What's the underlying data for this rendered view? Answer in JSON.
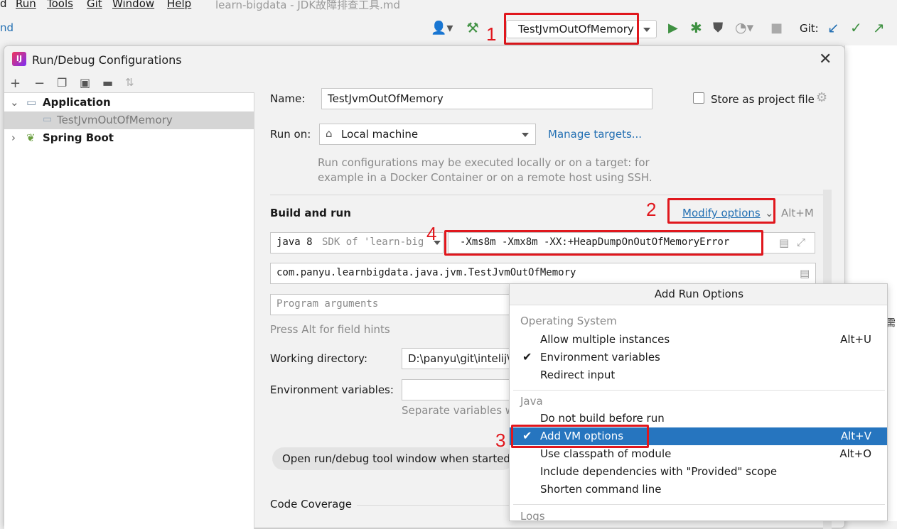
{
  "menubar": {
    "items": [
      {
        "label": "d",
        "mnemonic": ""
      },
      {
        "label": "Run",
        "mnemonic": "R"
      },
      {
        "label": "Tools",
        "mnemonic": "T"
      },
      {
        "label": "Git",
        "mnemonic": "G"
      },
      {
        "label": "Window",
        "mnemonic": "W"
      },
      {
        "label": "Help",
        "mnemonic": "H"
      }
    ],
    "window_title": "learn-bigdata - JDK故障排查工具.md"
  },
  "toolbar": {
    "left_text": "nd",
    "run_config": "TestJvmOutOfMemory",
    "git_label": "Git:"
  },
  "annotations": {
    "n1": "1",
    "n2": "2",
    "n3": "3",
    "n4": "4"
  },
  "dialog": {
    "title": "Run/Debug Configurations",
    "logo_text": "IJ",
    "tree": {
      "application": "Application",
      "selected_config": "TestJvmOutOfMemory",
      "spring_boot": "Spring Boot"
    },
    "form": {
      "name_label": "Name:",
      "name_value": "TestJvmOutOfMemory",
      "store_label": "Store as project file",
      "run_on_label": "Run on:",
      "run_on_value": "Local machine",
      "manage_targets": "Manage targets...",
      "run_on_hint_1": "Run configurations may be executed locally or on a target: for",
      "run_on_hint_2": "example in a Docker Container or on a remote host using SSH.",
      "build_and_run": "Build and run",
      "modify_options": "Modify options",
      "modify_shortcut": "Alt+M",
      "sdk_value": "java 8",
      "sdk_hint": "SDK of 'learn-big",
      "vm_options": "-Xms8m -Xmx8m -XX:+HeapDumpOnOutOfMemoryError",
      "main_class": "com.panyu.learnbigdata.java.jvm.TestJvmOutOfMemory",
      "program_args_placeholder": "Program arguments",
      "field_hints": "Press Alt for field hints",
      "working_dir_label": "Working directory:",
      "working_dir_value": "D:\\panyu\\git\\intelij\\",
      "env_label": "Environment variables:",
      "env_hint": "Separate variables w",
      "open_tool_window": "Open run/debug tool window when started",
      "code_coverage": "Code Coverage"
    }
  },
  "popup": {
    "title": "Add Run Options",
    "groups": [
      {
        "name": "Operating System",
        "items": [
          {
            "label": "Allow multiple instances",
            "shortcut": "Alt+U",
            "checked": false
          },
          {
            "label": "Environment variables",
            "shortcut": "",
            "checked": true
          },
          {
            "label": "Redirect input",
            "shortcut": "",
            "checked": false
          }
        ]
      },
      {
        "name": "Java",
        "items": [
          {
            "label": "Do not build before run",
            "shortcut": "",
            "checked": false
          },
          {
            "label": "Add VM options",
            "shortcut": "Alt+V",
            "checked": true,
            "selected": true
          },
          {
            "label": "Use classpath of module",
            "shortcut": "Alt+O",
            "checked": false
          },
          {
            "label": "Include dependencies with \"Provided\" scope",
            "shortcut": "",
            "checked": false
          },
          {
            "label": "Shorten command line",
            "shortcut": "",
            "checked": false
          }
        ]
      },
      {
        "name": "Logs",
        "items": []
      }
    ]
  },
  "editor_right": {
    "cjk_char": "需"
  },
  "colors": {
    "accent_red": "#e0171d",
    "selection_blue": "#2675bf",
    "link_blue": "#2470b3"
  },
  "icons": [
    "user-icon",
    "hammer-icon",
    "run-icon",
    "debug-icon",
    "coverage-icon",
    "profile-icon",
    "stop-icon",
    "git-update-icon",
    "git-commit-icon",
    "git-push-icon",
    "add-icon",
    "remove-icon",
    "copy-icon",
    "save-icon",
    "folder-icon",
    "sort-icon",
    "close-icon",
    "gear-icon",
    "house-icon",
    "expand-icon",
    "document-icon"
  ]
}
